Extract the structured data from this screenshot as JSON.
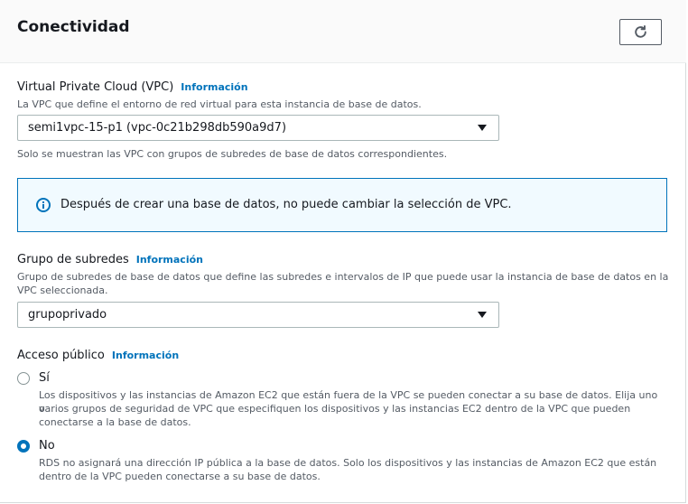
{
  "section": {
    "title": "Conectividad",
    "refresh_icon": "refresh-icon"
  },
  "vpc": {
    "label": "Virtual Private Cloud (VPC)",
    "info": "Información",
    "description": "La VPC que define el entorno de red virtual para esta instancia de base de datos.",
    "selected": "semi1vpc-15-p1 (vpc-0c21b298db590a9d7)",
    "hint": "Solo se muestran las VPC con grupos de subredes de base de datos correspondientes."
  },
  "alert": {
    "icon": "info-circle-icon",
    "message": "Después de crear una base de datos, no puede cambiar la selección de VPC."
  },
  "subnet_group": {
    "label": "Grupo de subredes",
    "info": "Información",
    "description_line1": "Grupo de subredes de base de datos que define las subredes e intervalos de IP que puede usar la instancia de base de datos en la",
    "description_line2": "VPC seleccionada.",
    "selected": "grupoprivado"
  },
  "public_access": {
    "label": "Acceso público",
    "info": "Información",
    "options": [
      {
        "label": "Sí",
        "selected": false,
        "description_lines": [
          "Los dispositivos y las instancias de Amazon EC2 que están fuera de la VPC se pueden conectar a su base de datos. Elija uno o",
          "varios grupos de seguridad de VPC que especifiquen los dispositivos y las instancias EC2 dentro de la VPC que pueden",
          "conectarse a la base de datos."
        ]
      },
      {
        "label": "No",
        "selected": true,
        "description_lines": [
          "RDS no asignará una dirección IP pública a la base de datos. Solo los dispositivos y las instancias de Amazon EC2 que están",
          "dentro de la VPC pueden conectarse a su base de datos."
        ]
      }
    ]
  },
  "colors": {
    "link": "#0073bb",
    "radio_selected": "#0073bb",
    "alert_border": "#0073bb",
    "alert_bg": "#f1faff"
  }
}
